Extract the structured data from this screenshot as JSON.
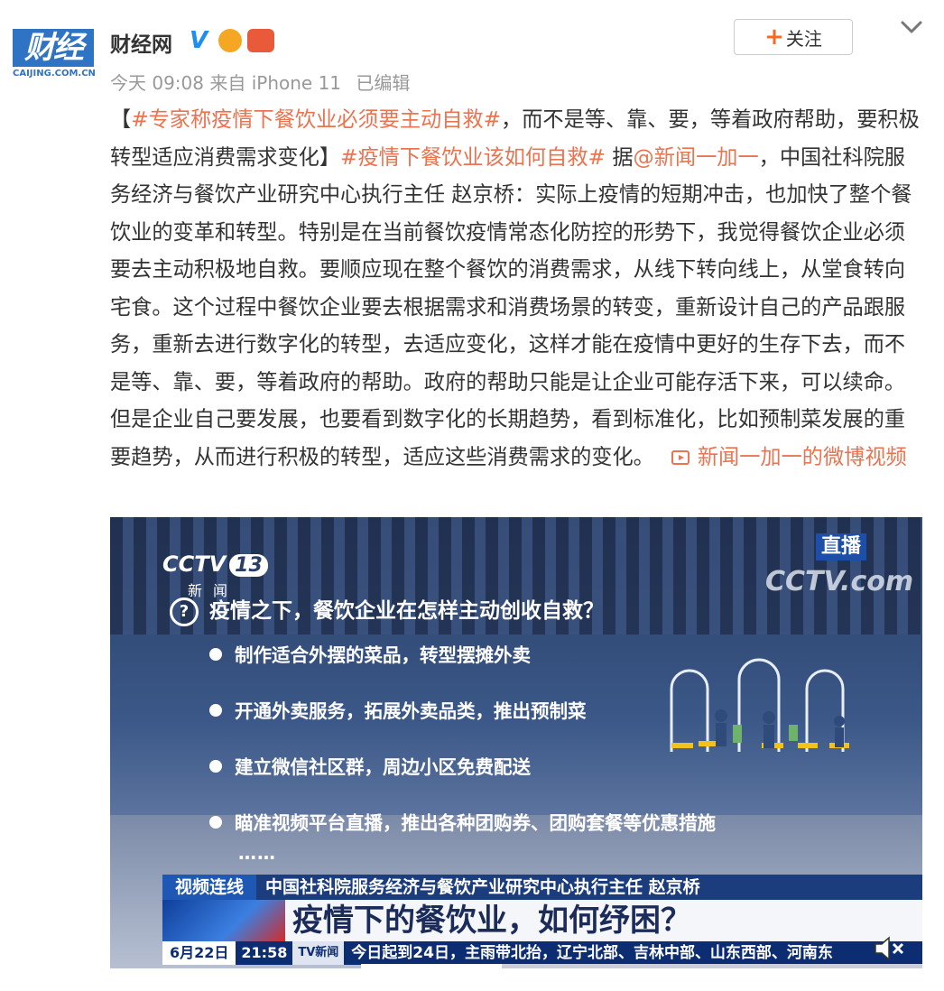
{
  "header": {
    "avatar_text": "财经网",
    "avatar_sub": "CAIJING.COM.CN",
    "account_name": "财经网",
    "time": "今天 09:08",
    "source": "来自 iPhone 11",
    "edited": "已编辑",
    "follow_label": "关注"
  },
  "post": {
    "open_bracket": "【",
    "tag1": "#专家称疫情下餐饮业必须要主动自救#",
    "text1": "，而不是等、靠、要，等着政府帮助，要积极转型适应消费需求变化】",
    "tag2": "#疫情下餐饮业该如何自救#",
    "text2": " 据",
    "mention": "@新闻一加一",
    "text3": "，中国社科院服务经济与餐饮产业研究中心执行主任 赵京桥：实际上疫情的短期冲击，也加快了整个餐饮业的变革和转型。特别是在当前餐饮疫情常态化防控的形势下，我觉得餐饮企业必须要去主动积极地自救。要顺应现在整个餐饮的消费需求，从线下转向线上，从堂食转向宅食。这个过程中餐饮企业要去根据需求和消费场景的转变，重新设计自己的产品跟服务，重新去进行数字化的转型，去适应变化，这样才能在疫情中更好的生存下去，而不是等、靠、要，等着政府的帮助。政府的帮助只能是让企业可能存活下来，可以续命。但是企业自己要发展，也要看到数字化的长期趋势，看到标准化，比如预制菜发展的重要趋势，从而进行积极的转型，适应这些消费需求的变化。",
    "video_link": "新闻一加一的微博视频"
  },
  "video": {
    "channel": "CCTV",
    "channel_num": "13",
    "channel_sub": "新闻",
    "live": "直播",
    "watermark": "CCTV.com",
    "question": "疫情之下，餐饮企业在怎样主动创收自救？",
    "bullets": [
      "制作适合外摆的菜品，转型摆摊外卖",
      "开通外卖服务，拓展外卖品类，推出预制菜",
      "建立微信社区群，周边小区免费配送",
      "瞄准视频平台直播，推出各种团购券、团购套餐等优惠措施"
    ],
    "ellipsis": "……",
    "lower_tag": "视频连线",
    "lower_who": "中国社科院服务经济与餐饮产业研究中心执行主任 赵京桥",
    "headline": "疫情下的餐饮业，如何纾困？",
    "ticker_date": "6月22日",
    "ticker_time": "21:58",
    "ticker_logo": "TV新闻",
    "ticker_text": "今日起到24日，主雨带北抬，辽宁北部、吉林中部、山东西部、河南东",
    "progress": 0.25
  },
  "colors": {
    "link": "#eb7350",
    "follow_plus": "#f86a24",
    "verified": "#1e8ef0"
  }
}
